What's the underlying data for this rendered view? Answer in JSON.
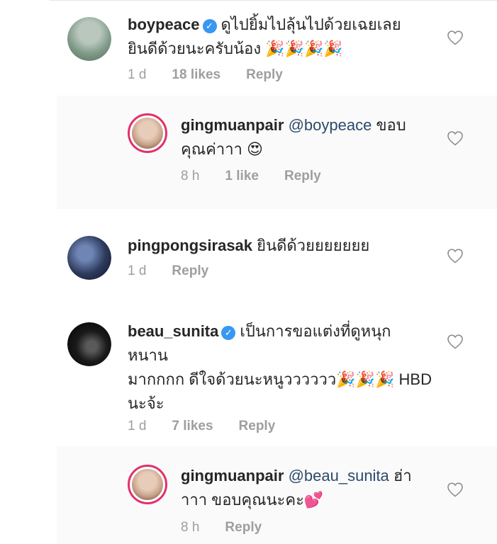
{
  "comments": [
    {
      "username": "boypeace",
      "verified": true,
      "text": "ดูไปยิ้มไปลุ้นไปด้วยเฉยเลย",
      "text2": "ยินดีด้วยนะครับน้อง 🎉🎉🎉🎉",
      "time": "1 d",
      "likes": "18 likes",
      "reply": "Reply",
      "avatar_color": "#7f9a87"
    },
    {
      "username": "gingmuanpair",
      "mention": "@boypeace",
      "text": "ขอบ",
      "text2": "คุณค่าาา 😍",
      "time": "8 h",
      "likes": "1 like",
      "reply": "Reply",
      "avatar_color": "#c9a48a"
    },
    {
      "username": "pingpongsirasak",
      "text": "ยินดีด้วยยยยยยย",
      "time": "1 d",
      "reply": "Reply",
      "avatar_color": "#2d3a5c"
    },
    {
      "username": "beau_sunita",
      "verified": true,
      "text": "เป็นการขอแต่งที่ดูหนุก",
      "text2": "หนาน",
      "text3": "มากกกก ดีใจด้วยนะหนูวววววว🎉🎉🎉 HBD",
      "text4": "นะจ้ะ",
      "time": "1 d",
      "likes": "7 likes",
      "reply": "Reply",
      "avatar_color": "#111111"
    },
    {
      "username": "gingmuanpair",
      "mention": "@beau_sunita",
      "text": "ฮ่า",
      "text2": "าาา ขอบคุณนะคะ💕",
      "time": "8 h",
      "reply": "Reply",
      "avatar_color": "#c9a48a"
    }
  ],
  "colors": {
    "link": "#2d4a6b",
    "verified": "#3897f0",
    "story_ring": "#e1306c",
    "meta": "#9e9e9e"
  },
  "icons": [
    "verified-badge-icon",
    "heart-outline-icon"
  ]
}
